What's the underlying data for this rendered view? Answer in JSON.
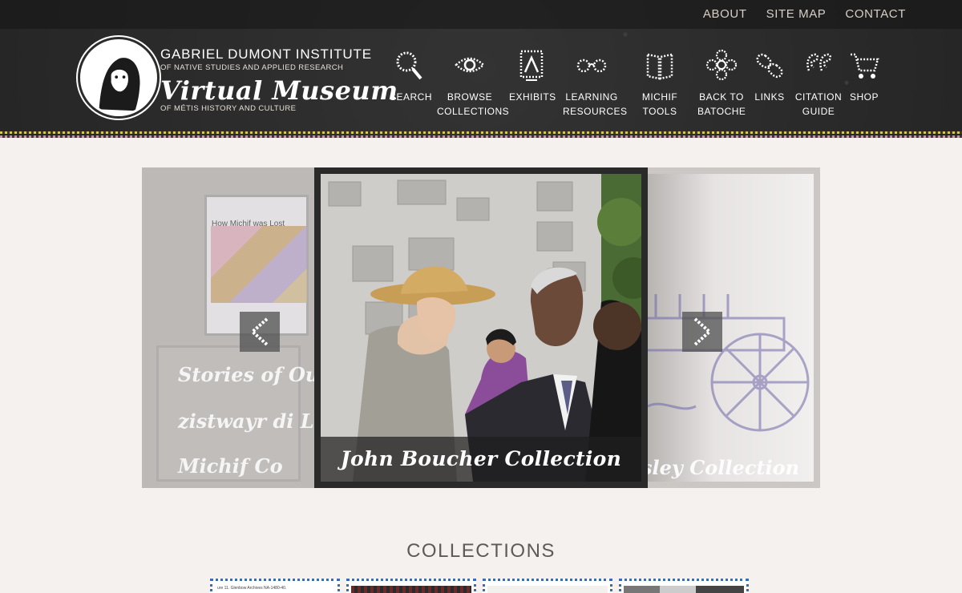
{
  "top_links": [
    "ABOUT",
    "SITE MAP",
    "CONTACT"
  ],
  "logo": {
    "org": "GABRIEL DUMONT INSTITUTE",
    "org_sub": "OF NATIVE STUDIES AND APPLIED RESEARCH",
    "title": "Virtual Museum",
    "title_sub": "OF MÉTIS HISTORY AND CULTURE"
  },
  "nav": [
    {
      "icon": "search-icon",
      "line1": "SEARCH",
      "line2": ""
    },
    {
      "icon": "eye-icon",
      "line1": "BROWSE",
      "line2": "COLLECTIONS"
    },
    {
      "icon": "easel-icon",
      "line1": "EXHIBITS",
      "line2": ""
    },
    {
      "icon": "glasses-icon",
      "line1": "LEARNING",
      "line2": "RESOURCES"
    },
    {
      "icon": "book-icon",
      "line1": "MICHIF",
      "line2": "TOOLS"
    },
    {
      "icon": "flower-icon",
      "line1": "BACK TO",
      "line2": "BATOCHE"
    },
    {
      "icon": "link-icon",
      "line1": "LINKS",
      "line2": ""
    },
    {
      "icon": "quote-icon",
      "line1": "CITATION",
      "line2": "GUIDE"
    },
    {
      "icon": "cart-icon",
      "line1": "SHOP",
      "line2": ""
    }
  ],
  "carousel": {
    "left_captions": [
      "Stories of Our",
      "zistwayr di L",
      "Michif Co"
    ],
    "left_poster_title": "How Michif was Lost",
    "center_caption": "John Boucher Collection",
    "right_caption": "sley Collection"
  },
  "collections": {
    "title": "COLLECTIONS",
    "thumb_text": "ure 11. Glenbow Archives NA-1480-40."
  }
}
